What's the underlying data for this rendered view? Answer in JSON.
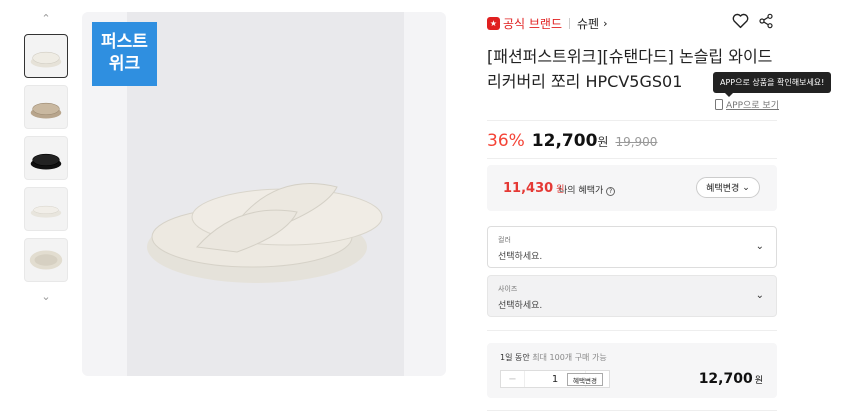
{
  "badge": {
    "line1": "퍼스트",
    "line2": "위크"
  },
  "brand": {
    "official_label": "공식 브랜드",
    "name": "슈펜",
    "arrow": "›"
  },
  "product": {
    "title": "[패션퍼스트위크][슈탠다드] 논슬립 와이드 리커버리 쪼리 HPCV5GS01"
  },
  "app": {
    "tooltip": "APP으로 상품을 확인해보세요!",
    "link": "APP으로 보기"
  },
  "price": {
    "discount": "36%",
    "sale": "12,700",
    "unit": "원",
    "original": "19,900"
  },
  "benefit": {
    "price": "11,430",
    "unit": "원",
    "label": "나의 혜택가",
    "button": "혜택변경"
  },
  "options": [
    {
      "label": "컬러",
      "placeholder": "선택하세요."
    },
    {
      "label": "사이즈",
      "placeholder": "선택하세요."
    }
  ],
  "order": {
    "limit_prefix": "1일 동안",
    "limit_suffix": "최대 100개 구매 가능",
    "qty": "1",
    "minus": "−",
    "plus": "+",
    "benefit_button": "혜택변경",
    "price": "12,700",
    "unit": "원"
  },
  "icons": [
    "chevron-up-icon",
    "chevron-down-icon",
    "heart-icon",
    "share-icon",
    "phone-icon",
    "question-icon"
  ],
  "colors": {
    "accent_red": "#e53935",
    "badge_blue": "#2f8fe0",
    "discount_red": "#f44336"
  }
}
